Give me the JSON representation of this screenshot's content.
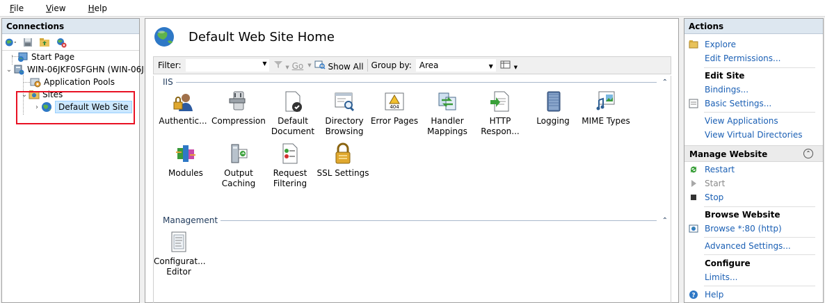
{
  "menu": {
    "file": "File",
    "file_u": "F",
    "file_rest": "ile",
    "view_u": "V",
    "view_rest": "iew",
    "help_u": "H",
    "help_rest": "elp"
  },
  "connections": {
    "title": "Connections",
    "tree": {
      "start_page": "Start Page",
      "server": "WIN-06JKF0SFGHN (WIN-06JK",
      "app_pools": "Application Pools",
      "sites": "Sites",
      "default_site": "Default Web Site"
    }
  },
  "center": {
    "title": "Default Web Site Home",
    "filter_label": "Filter:",
    "go_label": "Go",
    "show_all_label": "Show All",
    "group_by_label": "Group by:",
    "group_by_value": "Area",
    "sections": {
      "iis": "IIS",
      "management": "Management"
    },
    "iis_features": [
      {
        "line1": "Authentic...",
        "line2": ""
      },
      {
        "line1": "Compression",
        "line2": ""
      },
      {
        "line1": "Default",
        "line2": "Document"
      },
      {
        "line1": "Directory",
        "line2": "Browsing"
      },
      {
        "line1": "Error Pages",
        "line2": ""
      },
      {
        "line1": "Handler",
        "line2": "Mappings"
      },
      {
        "line1": "HTTP",
        "line2": "Respon..."
      },
      {
        "line1": "Logging",
        "line2": ""
      },
      {
        "line1": "MIME Types",
        "line2": ""
      },
      {
        "line1": "Modules",
        "line2": ""
      },
      {
        "line1": "Output",
        "line2": "Caching"
      },
      {
        "line1": "Request",
        "line2": "Filtering"
      },
      {
        "line1": "SSL Settings",
        "line2": ""
      }
    ],
    "management_features": [
      {
        "line1": "Configurat...",
        "line2": "Editor"
      }
    ]
  },
  "actions": {
    "title": "Actions",
    "explore": "Explore",
    "edit_permissions": "Edit Permissions...",
    "edit_site": "Edit Site",
    "bindings": "Bindings...",
    "basic_settings": "Basic Settings...",
    "view_applications": "View Applications",
    "view_virtual_dirs": "View Virtual Directories",
    "manage_website": "Manage Website",
    "restart": "Restart",
    "start": "Start",
    "stop": "Stop",
    "browse_website": "Browse Website",
    "browse_80": "Browse *:80 (http)",
    "advanced_settings": "Advanced Settings...",
    "configure": "Configure",
    "limits": "Limits...",
    "help": "Help"
  },
  "colors": {
    "link": "#1a5fb4",
    "header_bg": "#dde7f0",
    "highlight": "#e81123"
  }
}
